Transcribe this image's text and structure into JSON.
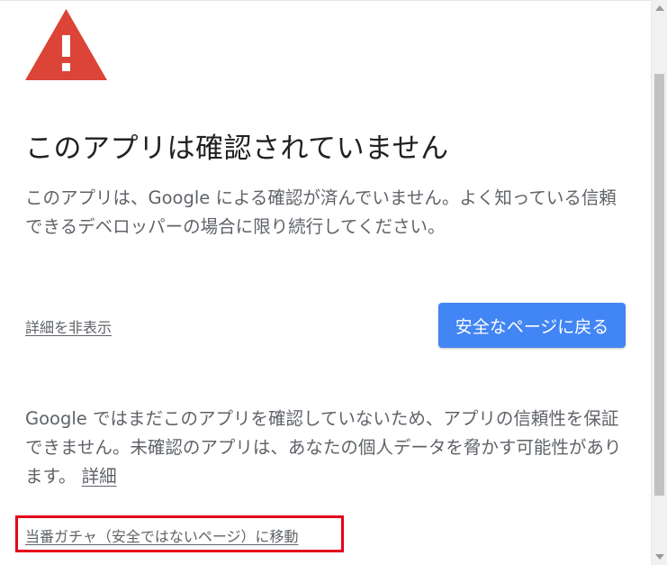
{
  "warning": {
    "icon": "warning-triangle-icon",
    "color": "#db4437"
  },
  "title": "このアプリは確認されていません",
  "description": "このアプリは、Google による確認が済んでいません。よく知っている信頼できるデベロッパーの場合に限り続行してください。",
  "actions": {
    "hide_details": "詳細を非表示",
    "back_to_safety": "安全なページに戻る",
    "back_button_color": "#4285f4"
  },
  "details": {
    "text": "Google ではまだこのアプリを確認していないため、アプリの信頼性を保証できません。未確認のアプリは、あなたの個人データを脅かす可能性があります。",
    "link_label": "詳細"
  },
  "proceed": {
    "label": "当番ガチャ（安全ではないページ）に移動",
    "highlight_color": "#e3001b"
  }
}
